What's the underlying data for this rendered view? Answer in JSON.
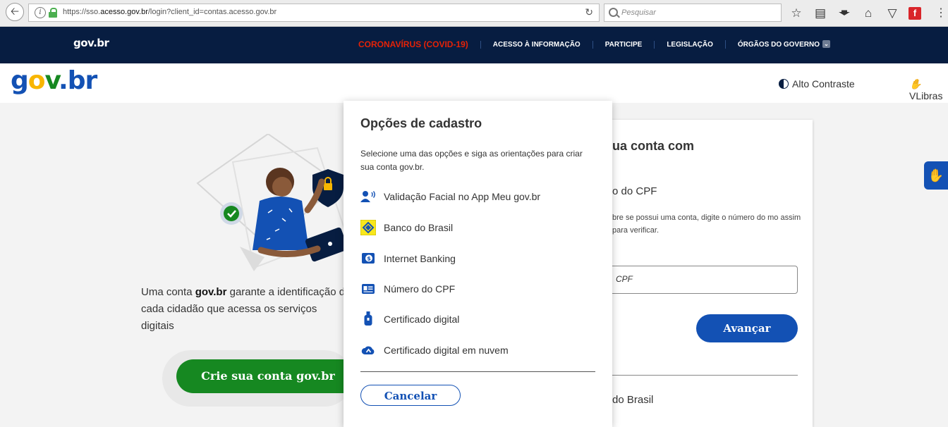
{
  "browser": {
    "url_prefix": "https://sso.",
    "url_domain": "acesso.gov.br",
    "url_path": "/login?client_id=contas.acesso.gov.br",
    "search_placeholder": "Pesquisar"
  },
  "topstrip": {
    "logo": "gov.br",
    "links": [
      "CORONAVÍRUS (COVID-19)",
      "ACESSO À INFORMAÇÃO",
      "PARTICIPE",
      "LEGISLAÇÃO",
      "ÓRGÃOS DO GOVERNO"
    ]
  },
  "header": {
    "logo": "gov.br",
    "contrast_label": "Alto Contraste",
    "vlibras_label": "VLibras"
  },
  "intro": {
    "pre": "Uma conta ",
    "bold": "gov.br",
    "post": " garante a identificação de cada cidadão que acessa os serviços digitais"
  },
  "create_button": "Crie sua conta gov.br",
  "login_card": {
    "title": "ua conta com",
    "subtitle": "o do CPF",
    "desc": "bre se possui uma conta, digite o número do mo assim para verificar.",
    "cpf_placeholder": "CPF",
    "advance_button": "Avançar",
    "bb_label": "do Brasil"
  },
  "modal": {
    "title": "Opções de cadastro",
    "desc": "Selecione uma das opções e siga as orientações para criar sua conta gov.br.",
    "options": [
      {
        "label": "Validação Facial no App Meu gov.br",
        "icon": "face-id-icon"
      },
      {
        "label": "Banco do Brasil",
        "icon": "banco-do-brasil-icon"
      },
      {
        "label": "Internet Banking",
        "icon": "internet-banking-icon"
      },
      {
        "label": "Número do CPF",
        "icon": "id-card-icon"
      },
      {
        "label": "Certificado digital",
        "icon": "usb-token-icon"
      },
      {
        "label": "Certificado digital em nuvem",
        "icon": "cloud-certificate-icon"
      }
    ],
    "cancel_button": "Cancelar"
  },
  "colors": {
    "gov_blue": "#1351b4",
    "gov_navy": "#071d41",
    "gov_green": "#168821",
    "gov_yellow": "#f8b600",
    "covid_red": "#e52207"
  }
}
